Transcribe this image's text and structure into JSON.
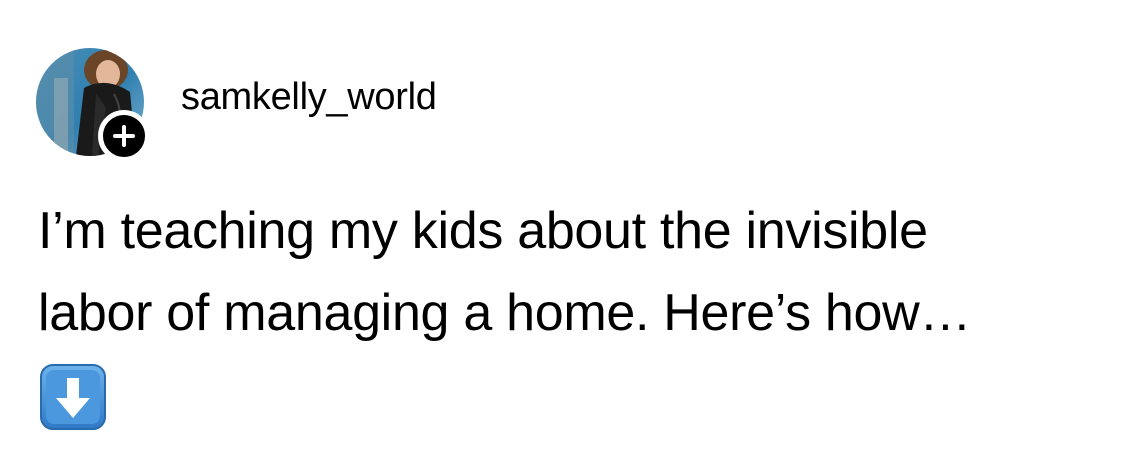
{
  "post": {
    "author": {
      "username": "samkelly_world",
      "avatar_icon": "profile-photo",
      "follow_icon": "plus-icon"
    },
    "text_lines": [
      "I’m teaching my kids about the invisible",
      "labor of managing a home. Here’s how…"
    ],
    "emoji": "down-arrow-emoji"
  },
  "colors": {
    "text": "#000000",
    "background": "#ffffff",
    "follow_badge": "#000000",
    "emoji_blue": "#3d8bd6"
  }
}
